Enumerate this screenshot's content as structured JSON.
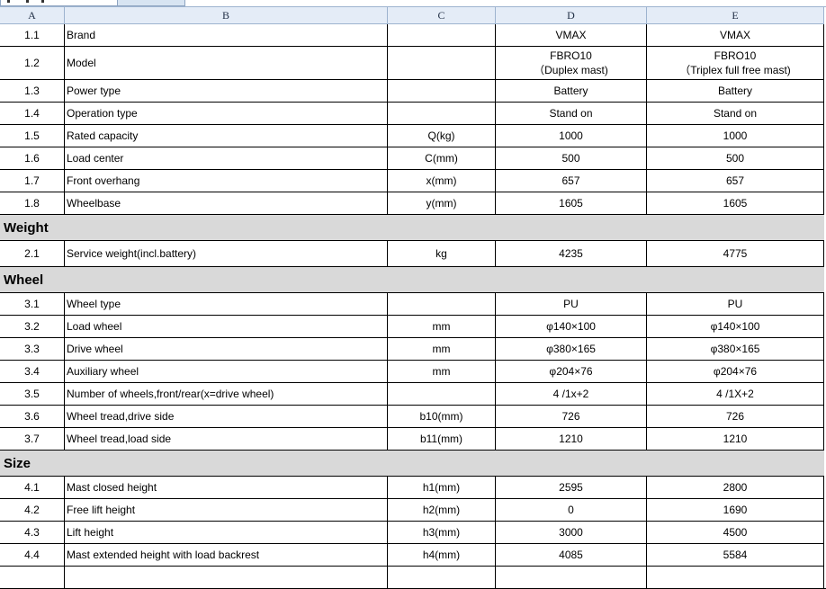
{
  "columns": [
    "A",
    "B",
    "C",
    "D",
    "E"
  ],
  "rows": [
    {
      "kind": "data",
      "h": "r25",
      "num": "1.1",
      "item": "Brand",
      "unit": "",
      "d": "VMAX",
      "e": "VMAX"
    },
    {
      "kind": "data2",
      "h": "r37",
      "num": "1.2",
      "item": "Model",
      "unit": "",
      "d": "FBRO10",
      "d2": "（Duplex mast)",
      "e": "FBRO10",
      "e2": "（Triplex full free mast)"
    },
    {
      "kind": "data",
      "h": "r25",
      "num": "1.3",
      "item": "Power type",
      "unit": "",
      "d": "Battery",
      "e": "Battery"
    },
    {
      "kind": "data",
      "h": "r25",
      "num": "1.4",
      "item": "Operation type",
      "unit": "",
      "d": "Stand on",
      "e": "Stand on"
    },
    {
      "kind": "data",
      "h": "r25",
      "num": "1.5",
      "item": "Rated capacity",
      "unit": "Q(kg)",
      "d": "1000",
      "e": "1000"
    },
    {
      "kind": "data",
      "h": "r25",
      "num": "1.6",
      "item": "Load center",
      "unit": "C(mm)",
      "d": "500",
      "e": "500"
    },
    {
      "kind": "data",
      "h": "r25",
      "num": "1.7",
      "item": "Front overhang",
      "unit": "x(mm)",
      "d": "657",
      "e": "657"
    },
    {
      "kind": "data",
      "h": "r25",
      "num": "1.8",
      "item": "Wheelbase",
      "unit": "y(mm)",
      "d": "1605",
      "e": "1605"
    },
    {
      "kind": "section",
      "title": "Weight"
    },
    {
      "kind": "data",
      "h": "r29",
      "num": "2.1",
      "item": "Service weight(incl.battery)",
      "unit": "kg",
      "d": "4235",
      "e": "4775"
    },
    {
      "kind": "section",
      "title": "Wheel"
    },
    {
      "kind": "data",
      "h": "r25",
      "num": "3.1",
      "item": "Wheel type",
      "unit": "",
      "d": "PU",
      "e": "PU"
    },
    {
      "kind": "data",
      "h": "r25",
      "num": "3.2",
      "item": "Load wheel",
      "unit": "mm",
      "d": "φ140×100",
      "e": "φ140×100"
    },
    {
      "kind": "data",
      "h": "r25",
      "num": "3.3",
      "item": "Drive wheel",
      "unit": "mm",
      "d": "φ380×165",
      "e": "φ380×165"
    },
    {
      "kind": "data",
      "h": "r25",
      "num": "3.4",
      "item": "Auxiliary wheel",
      "unit": "mm",
      "d": "φ204×76",
      "e": "φ204×76"
    },
    {
      "kind": "data",
      "h": "r25",
      "num": "3.5",
      "item": "Number of wheels,front/rear(x=drive wheel)",
      "unit": "",
      "d": "4 /1x+2",
      "e": "4 /1X+2"
    },
    {
      "kind": "data",
      "h": "r25",
      "num": "3.6",
      "item": "Wheel tread,drive side",
      "unit": "b10(mm)",
      "d": "726",
      "e": "726"
    },
    {
      "kind": "data",
      "h": "r25",
      "num": "3.7",
      "item": "Wheel tread,load side",
      "unit": "b11(mm)",
      "d": "1210",
      "e": "1210"
    },
    {
      "kind": "section",
      "title": "Size"
    },
    {
      "kind": "data",
      "h": "r25",
      "num": "4.1",
      "item": "Mast closed height",
      "unit": "h1(mm)",
      "d": "2595",
      "e": "2800"
    },
    {
      "kind": "data",
      "h": "r25",
      "num": "4.2",
      "item": "Free lift height",
      "unit": "h2(mm)",
      "d": "0",
      "e": "1690"
    },
    {
      "kind": "data",
      "h": "r25",
      "num": "4.3",
      "item": "Lift height",
      "unit": "h3(mm)",
      "d": "3000",
      "e": "4500"
    },
    {
      "kind": "data",
      "h": "r25",
      "num": "4.4",
      "item": "Mast extended height with load backrest",
      "unit": "h4(mm)",
      "d": "4085",
      "e": "5584"
    },
    {
      "kind": "data",
      "h": "r25",
      "num": "",
      "item": "",
      "unit": "",
      "d": "",
      "e": ""
    }
  ]
}
